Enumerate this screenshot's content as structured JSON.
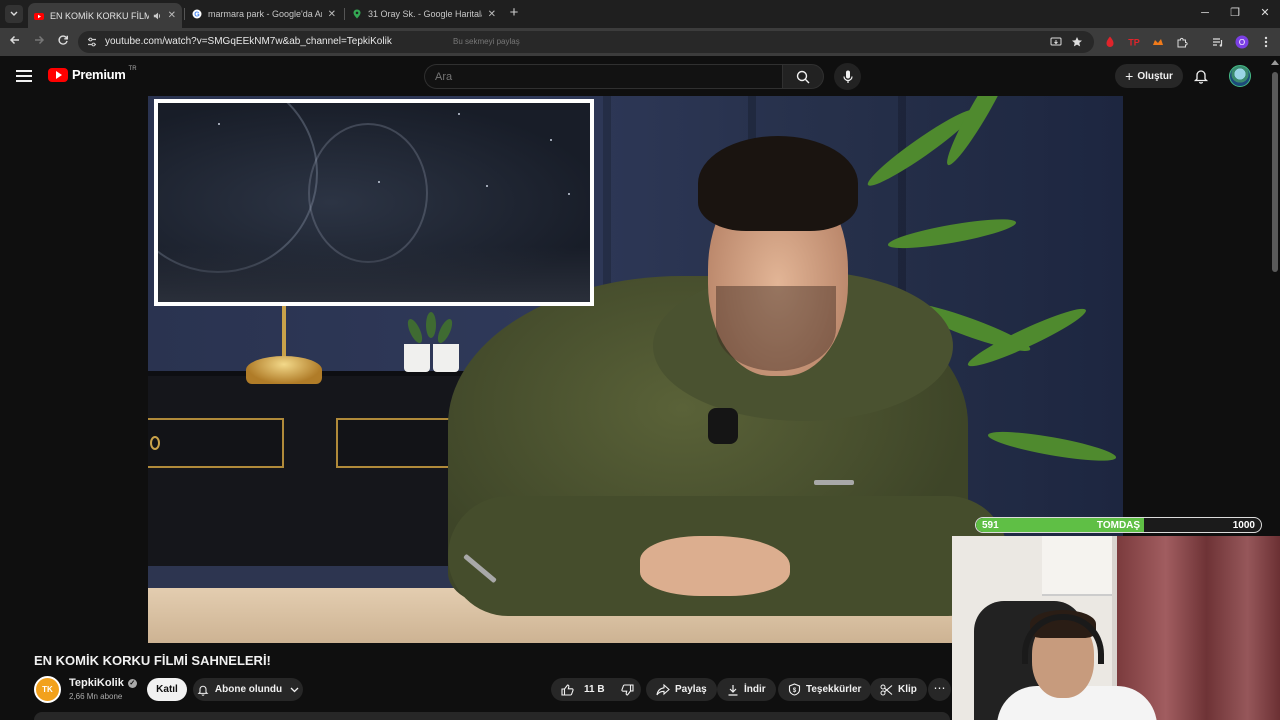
{
  "browser": {
    "tabs": [
      {
        "title": "EN KOMİK KORKU FİLMİ SA",
        "active": true,
        "favicon": "youtube-icon",
        "audio": true
      },
      {
        "title": "marmara park - Google'da Ara",
        "active": false,
        "favicon": "google-icon"
      },
      {
        "title": "31 Oray Sk. - Google Haritalar",
        "active": false,
        "favicon": "maps-pin-icon"
      }
    ],
    "url": "youtube.com/watch?v=SMGqEEkNM7w&ab_channel=TepkiKolik",
    "url_hint": "Bu sekmeyi paylaş"
  },
  "youtube": {
    "logo_text": "Premium",
    "logo_country": "TR",
    "search_placeholder": "Ara",
    "create_label": "Oluştur"
  },
  "overlay": {
    "xp_current": "591",
    "xp_name": "TOMDAŞ",
    "xp_max": "1000",
    "xp_fraction": 0.591
  },
  "video": {
    "title": "EN KOMİK KORKU FİLMİ SAHNELERİ!",
    "channel_name": "TepkiKolik",
    "channel_initials": "TK",
    "subscribers": "2,66 Mn abone",
    "join_label": "Katıl",
    "subscribed_label": "Abone olundu",
    "likes": "11 B",
    "share_label": "Paylaş",
    "download_label": "İndir",
    "thanks_label": "Teşekkürler",
    "clip_label": "Klip"
  },
  "colors": {
    "brand_red": "#ff0000",
    "xp_green": "#5fbf45",
    "background": "#0f0f0f"
  }
}
